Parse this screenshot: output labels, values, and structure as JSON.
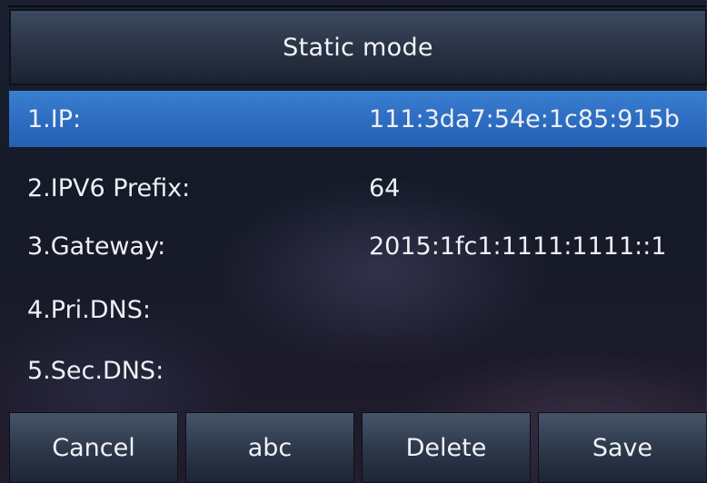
{
  "header": {
    "title": "Static mode"
  },
  "fields": [
    {
      "label": "1.IP:",
      "value": "111:3da7:54e:1c85:915b",
      "selected": true
    },
    {
      "label": "2.IPV6 Prefix:",
      "value": "64",
      "selected": false
    },
    {
      "label": "3.Gateway:",
      "value": "2015:1fc1:1111:1111::1",
      "selected": false
    },
    {
      "label": "4.Pri.DNS:",
      "value": "",
      "selected": false
    },
    {
      "label": "5.Sec.DNS:",
      "value": "",
      "selected": false
    }
  ],
  "softkeys": {
    "cancel": "Cancel",
    "abc": "abc",
    "delete": "Delete",
    "save": "Save"
  },
  "colors": {
    "selection": "#2f6fc4",
    "text": "#eef0f5"
  }
}
